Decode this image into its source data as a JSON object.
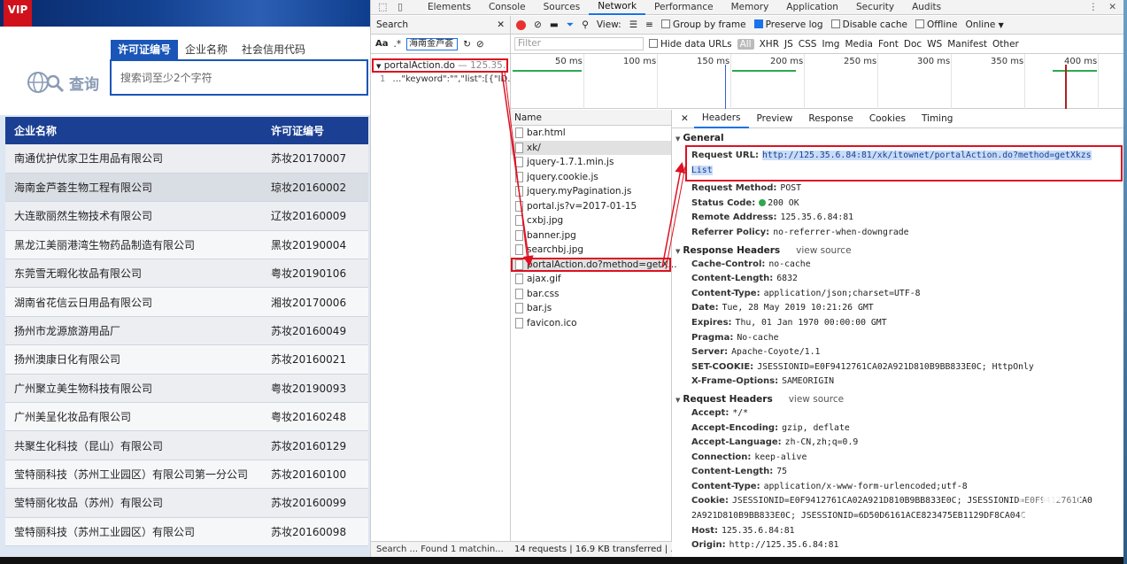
{
  "webpage": {
    "vip_badge": "VIP",
    "search_tabs": [
      "许可证编号",
      "企业名称",
      "社会信用代码"
    ],
    "search_label": "查询",
    "search_placeholder": "搜索词至少2个字符",
    "table": {
      "headers": [
        "企业名称",
        "许可证编号"
      ],
      "rows": [
        [
          "南通优护优家卫生用品有限公司",
          "苏妆20170007"
        ],
        [
          "海南金芦荟生物工程有限公司",
          "琼妆20160002"
        ],
        [
          "大连歌丽然生物技术有限公司",
          "辽妆20160009"
        ],
        [
          "黑龙江美丽港湾生物药品制造有限公司",
          "黑妆20190004"
        ],
        [
          "东莞雪无暇化妆品有限公司",
          "粤妆20190106"
        ],
        [
          "湖南省花信云日用品有限公司",
          "湘妆20170006"
        ],
        [
          "扬州市龙源旅游用品厂",
          "苏妆20160049"
        ],
        [
          "扬州澳康日化有限公司",
          "苏妆20160021"
        ],
        [
          "广州聚立美生物科技有限公司",
          "粤妆20190093"
        ],
        [
          "广州美呈化妆品有限公司",
          "粤妆20160248"
        ],
        [
          "共聚生化科技（昆山）有限公司",
          "苏妆20160129"
        ],
        [
          "莹特丽科技（苏州工业园区）有限公司第一分公司",
          "苏妆20160100"
        ],
        [
          "莹特丽化妆品（苏州）有限公司",
          "苏妆20160099"
        ],
        [
          "莹特丽科技（苏州工业园区）有限公司",
          "苏妆20160098"
        ]
      ]
    }
  },
  "devtools": {
    "top_tabs": [
      "Elements",
      "Console",
      "Sources",
      "Network",
      "Performance",
      "Memory",
      "Application",
      "Security",
      "Audits"
    ],
    "active_tab": "Network",
    "search_pane": {
      "title": "Search",
      "aa": "Aa",
      "regex": ".*",
      "query": "海南金芦荟",
      "result_file": "portalAction.do",
      "result_file_suffix": "— 125.35.6...",
      "result_line_no": "1",
      "result_line": "…\"keyword\":\"\",\"list\":[{\"ID…",
      "status": "Search ...  Found 1 matchin..."
    },
    "toolbar": {
      "view_label": "View:",
      "group_by_frame": "Group by frame",
      "preserve_log": "Preserve log",
      "disable_cache": "Disable cache",
      "offline": "Offline",
      "online": "Online"
    },
    "filter": {
      "placeholder": "Filter",
      "hide_data_urls": "Hide data URLs",
      "types": [
        "All",
        "XHR",
        "JS",
        "CSS",
        "Img",
        "Media",
        "Font",
        "Doc",
        "WS",
        "Manifest",
        "Other"
      ]
    },
    "timeline_ticks": [
      "50 ms",
      "100 ms",
      "150 ms",
      "200 ms",
      "250 ms",
      "300 ms",
      "350 ms",
      "400 ms"
    ],
    "files_header": "Name",
    "files": [
      "bar.html",
      "xk/",
      "jquery-1.7.1.min.js",
      "jquery.cookie.js",
      "jquery.myPagination.js",
      "portal.js?v=2017-01-15",
      "cxbj.jpg",
      "banner.jpg",
      "searchbj.jpg",
      "portalAction.do?method=getX...",
      "ajax.gif",
      "bar.css",
      "bar.js",
      "favicon.ico"
    ],
    "files_footer": "14 requests | 16.9 KB transferred | ...",
    "detail_tabs": [
      "Headers",
      "Preview",
      "Response",
      "Cookies",
      "Timing"
    ],
    "general": {
      "title": "General",
      "request_url_key": "Request URL:",
      "request_url_1": "http://125.35.6.84:81/xk/itownet/portalAction.do?method=getXkzs",
      "request_url_2": "List",
      "rows": [
        {
          "k": "Request Method:",
          "v": "POST"
        },
        {
          "k": "Status Code:",
          "v": "200 OK"
        },
        {
          "k": "Remote Address:",
          "v": "125.35.6.84:81"
        },
        {
          "k": "Referrer Policy:",
          "v": "no-referrer-when-downgrade"
        }
      ]
    },
    "response_headers": {
      "title": "Response Headers",
      "view_source": "view source",
      "rows": [
        {
          "k": "Cache-Control:",
          "v": "no-cache"
        },
        {
          "k": "Content-Length:",
          "v": "6832"
        },
        {
          "k": "Content-Type:",
          "v": "application/json;charset=UTF-8"
        },
        {
          "k": "Date:",
          "v": "Tue, 28 May 2019 10:21:26 GMT"
        },
        {
          "k": "Expires:",
          "v": "Thu, 01 Jan 1970 00:00:00 GMT"
        },
        {
          "k": "Pragma:",
          "v": "No-cache"
        },
        {
          "k": "Server:",
          "v": "Apache-Coyote/1.1"
        },
        {
          "k": "SET-COOKIE:",
          "v": "JSESSIONID=E0F9412761CA02A921D810B9BB833E0C; HttpOnly"
        },
        {
          "k": "X-Frame-Options:",
          "v": "SAMEORIGIN"
        }
      ]
    },
    "request_headers": {
      "title": "Request Headers",
      "view_source": "view source",
      "rows": [
        {
          "k": "Accept:",
          "v": "*/*"
        },
        {
          "k": "Accept-Encoding:",
          "v": "gzip, deflate"
        },
        {
          "k": "Accept-Language:",
          "v": "zh-CN,zh;q=0.9"
        },
        {
          "k": "Connection:",
          "v": "keep-alive"
        },
        {
          "k": "Content-Length:",
          "v": "75"
        },
        {
          "k": "Content-Type:",
          "v": "application/x-www-form-urlencoded;utf-8"
        },
        {
          "k": "Cookie:",
          "v": "JSESSIONID=E0F9412761CA02A921D810B9BB833E0C; JSESSIONID=E0F9412761CA0"
        },
        {
          "k": "",
          "v": "2A921D810B9BB833E0C; JSESSIONID=6D50D6161ACE823475EB1129DF8CA04C"
        },
        {
          "k": "Host:",
          "v": "125.35.6.84:81"
        },
        {
          "k": "Origin:",
          "v": "http://125.35.6.84:81"
        }
      ]
    }
  }
}
